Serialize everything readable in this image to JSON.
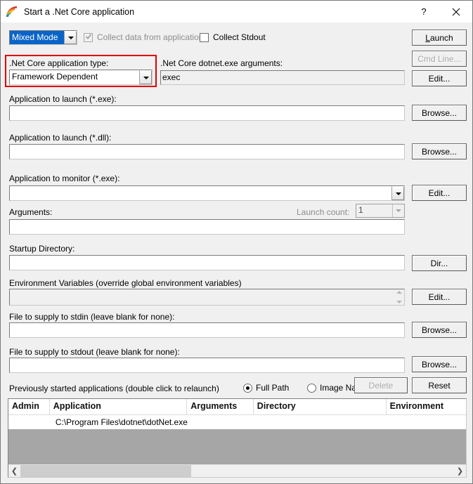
{
  "window": {
    "title": "Start a .Net Core application",
    "icon": "fan-chart-icon",
    "help_button": "?",
    "close_button": "✕"
  },
  "toolbar": {
    "mode_combo": {
      "value": "Mixed Mode",
      "selected": true
    },
    "collect_data_checkbox": {
      "label": "Collect data from application",
      "checked": true,
      "disabled": true
    },
    "collect_stdout_checkbox": {
      "label": "Collect Stdout",
      "checked": false,
      "disabled": false
    }
  },
  "fields": {
    "app_type_label": ".Net Core application type:",
    "app_type_value": "Framework Dependent",
    "dotnet_args_label": ".Net Core dotnet.exe arguments:",
    "dotnet_args_value": "exec",
    "launch_exe_label": "Application to launch (*.exe):",
    "launch_exe_value": "",
    "launch_dll_label": "Application to launch (*.dll):",
    "launch_dll_value": "",
    "monitor_exe_label": "Application to monitor (*.exe):",
    "monitor_exe_value": "",
    "arguments_label": "Arguments:",
    "arguments_value": "",
    "launch_count_label": "Launch count:",
    "launch_count_value": "1",
    "startup_dir_label": "Startup Directory:",
    "startup_dir_value": "",
    "env_vars_label": "Environment Variables (override global environment variables)",
    "env_vars_value": "",
    "stdin_label": "File to supply to stdin (leave blank for none):",
    "stdin_value": "",
    "stdout_label": "File to supply to stdout (leave blank for none):",
    "stdout_value": ""
  },
  "buttons": {
    "launch": "Launch",
    "launch_accel": "L",
    "launch_rest": "aunch",
    "cmd_line": "Cmd Line...",
    "edit_args": "Edit...",
    "browse_exe": "Browse...",
    "browse_dll": "Browse...",
    "edit_monitor": "Edit...",
    "dir": "Dir...",
    "edit_env": "Edit...",
    "browse_stdin": "Browse...",
    "browse_stdout": "Browse...",
    "delete": "Delete",
    "reset": "Reset"
  },
  "history": {
    "label": "Previously started applications (double click to relaunch)",
    "path_mode": {
      "full_path": "Full Path",
      "image_name": "Image Name",
      "selected": "Full Path"
    },
    "columns": [
      "Admin",
      "Application",
      "Arguments",
      "Directory",
      "Environment"
    ],
    "rows": [
      {
        "admin": "",
        "application": "C:\\Program Files\\dotnet\\dotNet.exe",
        "arguments": "",
        "directory": "",
        "environment": ""
      }
    ]
  },
  "colors": {
    "dialog_background": "#f0f0f0",
    "selection_blue": "#0a64c8",
    "highlight_red": "#e00000",
    "list_empty_gray": "#a6a6a6"
  }
}
